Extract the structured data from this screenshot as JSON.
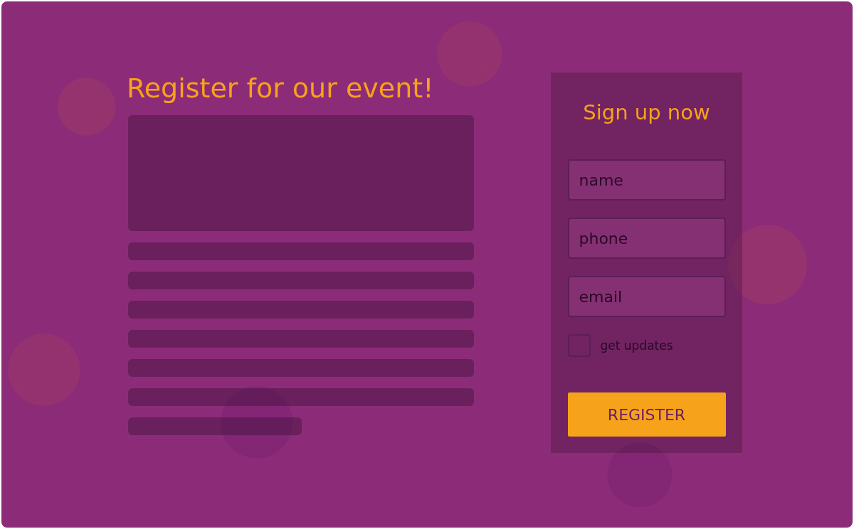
{
  "title": "Register for our event!",
  "signup": {
    "heading": "Sign up now",
    "fields": [
      {
        "placeholder": "name"
      },
      {
        "placeholder": "phone"
      },
      {
        "placeholder": "email"
      }
    ],
    "checkbox": {
      "label": "get updates",
      "checked": false
    },
    "button": "REGISTER"
  }
}
